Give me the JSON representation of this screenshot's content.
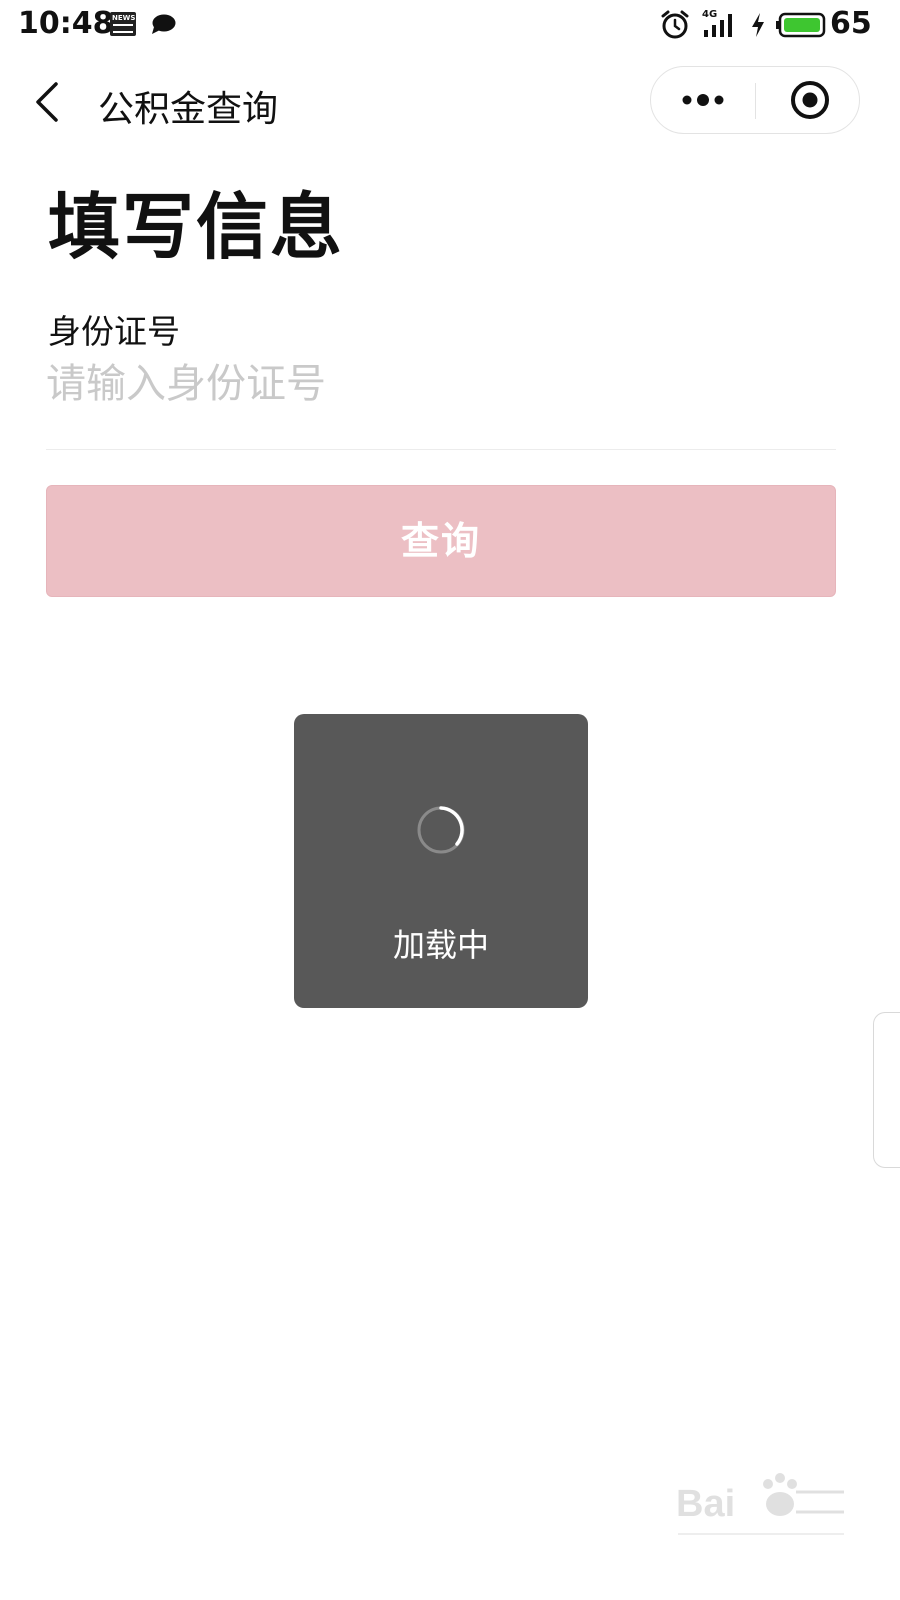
{
  "status_bar": {
    "time": "10:48",
    "news_badge": "NEWS",
    "network": "4G",
    "battery_level": "65"
  },
  "nav": {
    "title": "公积金查询"
  },
  "form": {
    "heading": "填写信息",
    "id_label": "身份证号",
    "id_placeholder": "请输入身份证号",
    "id_value": "",
    "submit_label": "查询"
  },
  "toast": {
    "text": "加载中"
  },
  "colors": {
    "submit_disabled": "#ecbfc4",
    "toast_bg": "#585858",
    "battery_fill": "#3ec630"
  },
  "icons": {
    "back": "chevron-left-icon",
    "more": "more-dots-icon",
    "close": "record-icon",
    "spinner": "spinner-icon"
  }
}
